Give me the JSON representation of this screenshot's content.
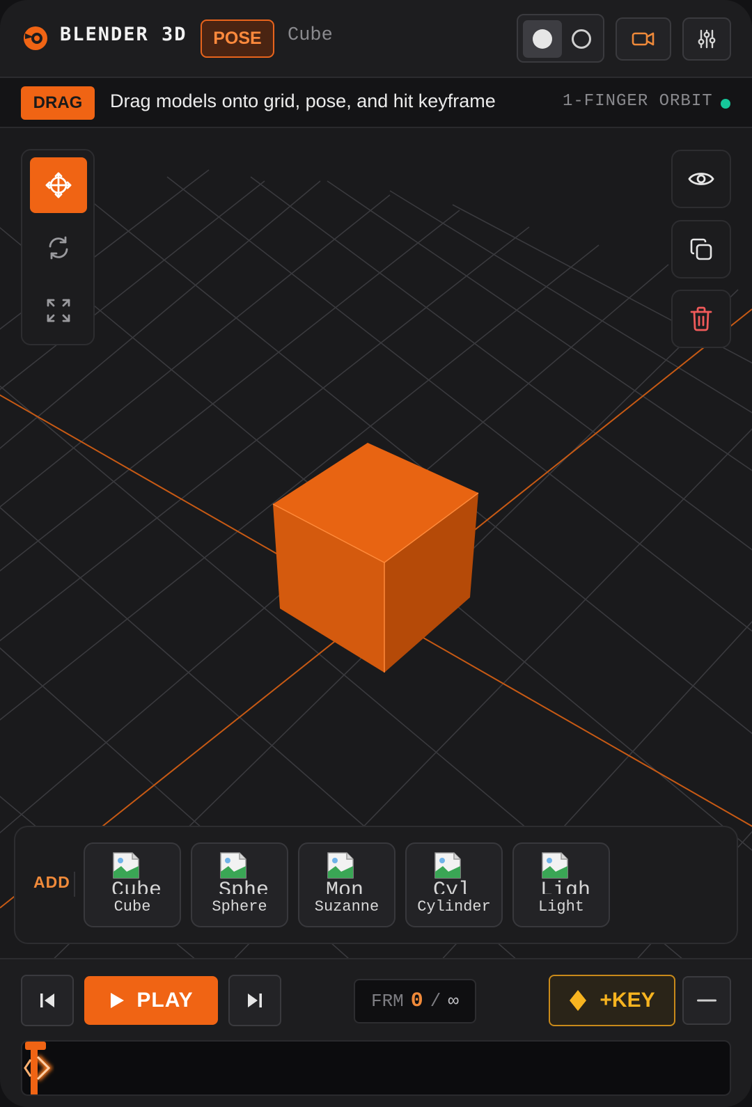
{
  "header": {
    "app_title": "BLENDER 3D",
    "mode": "POSE",
    "object_name": "Cube",
    "shading": {
      "solid_icon": "solid-sphere-icon",
      "wire_icon": "wireframe-circle-icon",
      "active": "solid"
    },
    "buttons": [
      {
        "icon": "camera-icon"
      },
      {
        "icon": "sliders-icon"
      }
    ]
  },
  "hint": {
    "tag": "DRAG",
    "text": "Drag models onto grid, pose, and hit keyframe",
    "gesture": "1-FINGER ORBIT"
  },
  "tools": [
    {
      "icon": "move-icon",
      "active": true
    },
    {
      "icon": "rotate-icon",
      "active": false
    },
    {
      "icon": "scale-icon",
      "active": false
    }
  ],
  "side_actions": [
    {
      "icon": "eye-icon"
    },
    {
      "icon": "duplicate-icon"
    },
    {
      "icon": "trash-icon"
    }
  ],
  "add_panel": {
    "label": "ADD",
    "items": [
      {
        "label": "Cube",
        "broken_alt": "Cube"
      },
      {
        "label": "Sphere",
        "broken_alt": "Sphere"
      },
      {
        "label": "Suzanne",
        "broken_alt": "Mon"
      },
      {
        "label": "Cylinder",
        "broken_alt": "Cyl"
      },
      {
        "label": "Light",
        "broken_alt": "Ligh"
      }
    ]
  },
  "transport": {
    "play_label": "PLAY",
    "frame_prefix": "FRM",
    "frame_current": "0",
    "frame_sep": "/",
    "frame_total": "∞",
    "key_label": "+KEY"
  },
  "colors": {
    "accent": "#f06414",
    "key": "#f7b420",
    "status_ok": "#16c79a",
    "danger": "#f05a5a"
  }
}
